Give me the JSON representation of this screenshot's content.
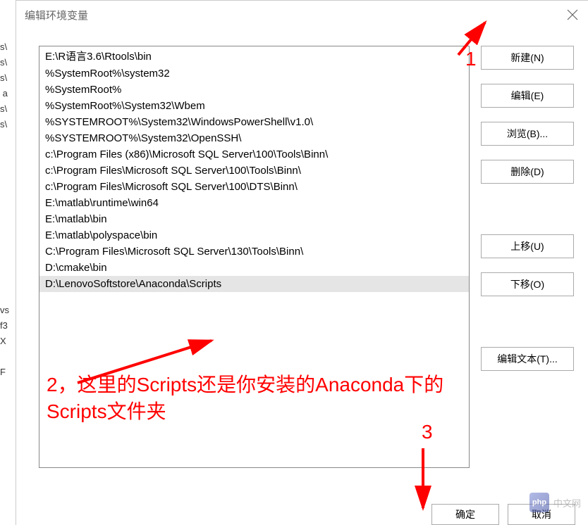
{
  "dialog": {
    "title": "编辑环境变量"
  },
  "bg_fragments": "s\\\ns\\\ns\\\n a\ns\\\ns\\\n\n\n\n\n\n\n\n\n\n\n\nvs\nf3\nX\n\nF",
  "path_entries": [
    "E:\\R语言3.6\\Rtools\\bin",
    "%SystemRoot%\\system32",
    "%SystemRoot%",
    "%SystemRoot%\\System32\\Wbem",
    "%SYSTEMROOT%\\System32\\WindowsPowerShell\\v1.0\\",
    "%SYSTEMROOT%\\System32\\OpenSSH\\",
    "c:\\Program Files (x86)\\Microsoft SQL Server\\100\\Tools\\Binn\\",
    "c:\\Program Files\\Microsoft SQL Server\\100\\Tools\\Binn\\",
    "c:\\Program Files\\Microsoft SQL Server\\100\\DTS\\Binn\\",
    "E:\\matlab\\runtime\\win64",
    "E:\\matlab\\bin",
    "E:\\matlab\\polyspace\\bin",
    "C:\\Program Files\\Microsoft SQL Server\\130\\Tools\\Binn\\",
    "D:\\cmake\\bin",
    "D:\\LenovoSoftstore\\Anaconda\\Scripts"
  ],
  "selected_index": 14,
  "buttons": {
    "new": "新建(N)",
    "edit": "编辑(E)",
    "browse": "浏览(B)...",
    "delete": "删除(D)",
    "moveup": "上移(U)",
    "movedown": "下移(O)",
    "edittext": "编辑文本(T)...",
    "ok": "确定",
    "cancel": "取消"
  },
  "annotations": {
    "n1": "1",
    "n2_text": "2，这里的Scripts还是你安装的Anaconda下的Scripts文件夹",
    "n3": "3"
  },
  "watermark": "中文网",
  "watermark_logo": "php"
}
